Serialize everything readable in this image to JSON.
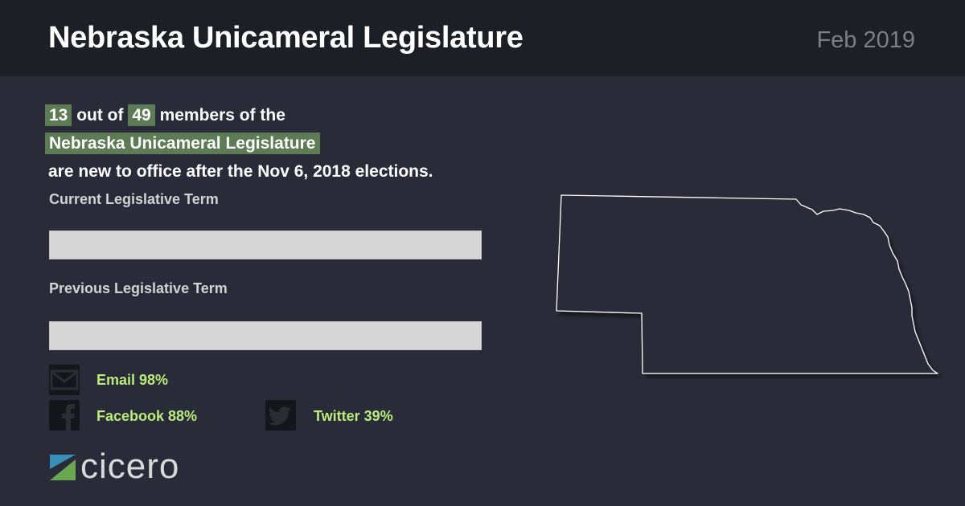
{
  "header": {
    "title": "Nebraska Unicameral Legislature",
    "date": "Feb 2019"
  },
  "summary": {
    "new_count": "13",
    "connector": "out of",
    "total_count": "49",
    "line1_tail": "members of the",
    "body_name": "Nebraska Unicameral Legislature",
    "line3": "are new to office after the Nov 6, 2018 elections."
  },
  "terms": {
    "current_label": "Current Legislative Term",
    "current_fraction": 0,
    "previous_label": "Previous Legislative Term",
    "previous_fraction": 0
  },
  "social": {
    "email": {
      "label": "Email 98%",
      "icon": "envelope-icon",
      "value_percent": 98
    },
    "facebook": {
      "label": "Facebook 88%",
      "icon": "facebook-icon",
      "value_percent": 88
    },
    "twitter": {
      "label": "Twitter 39%",
      "icon": "twitter-icon",
      "value_percent": 39
    }
  },
  "logo": {
    "text": "cicero"
  },
  "colors": {
    "background": "#292c38",
    "header": "#1d1f26",
    "highlight": "#5d7b55",
    "accent_text": "#b9ec7c",
    "bar": "#d6d6d6"
  }
}
